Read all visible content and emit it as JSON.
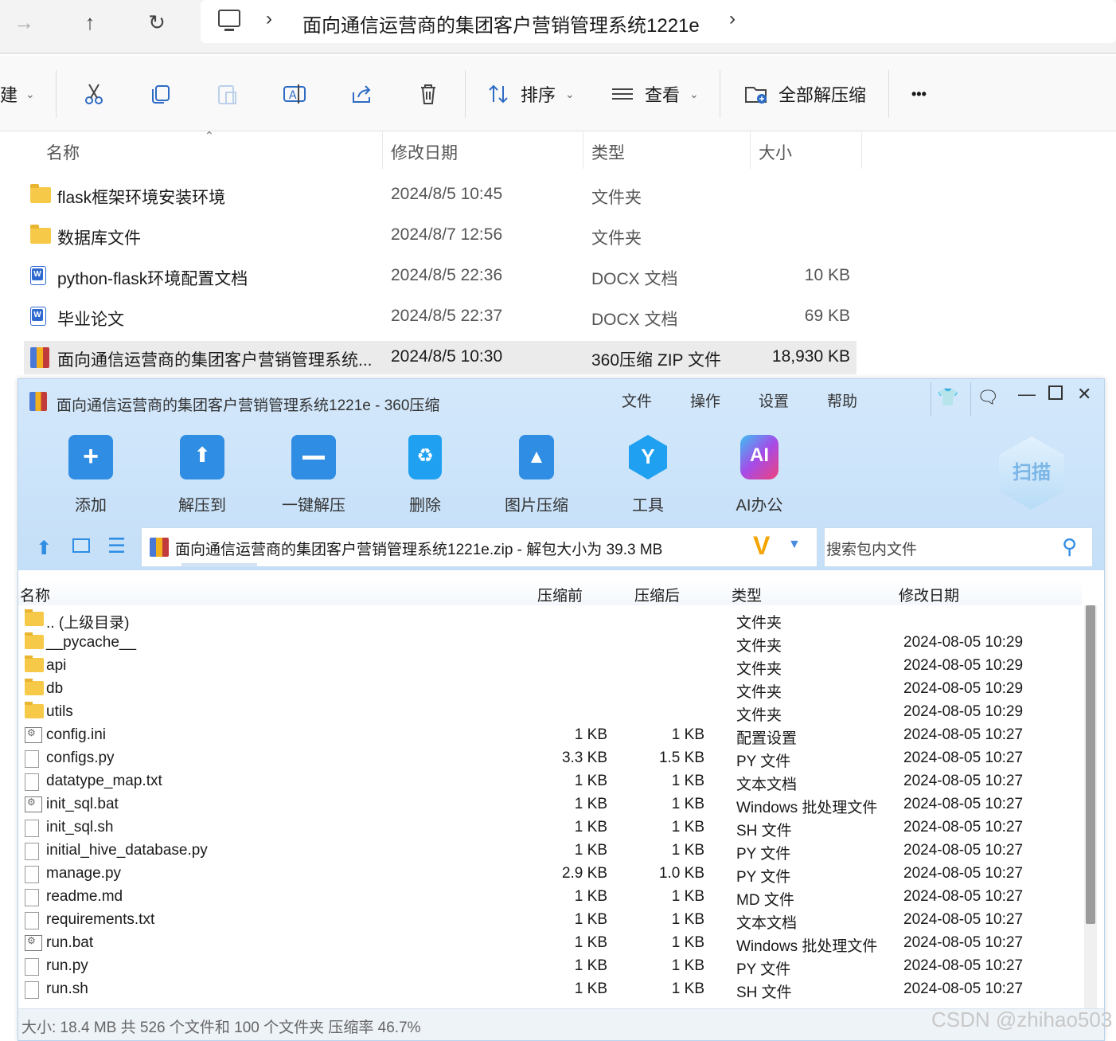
{
  "address": {
    "path": "面向通信运营商的集团客户营销管理系统1221e"
  },
  "toolbar": {
    "new_partial": "建",
    "sort": "排序",
    "view": "查看",
    "extract_all": "全部解压缩",
    "more": "•••"
  },
  "file_list": {
    "headers": {
      "name": "名称",
      "date": "修改日期",
      "type": "类型",
      "size": "大小"
    },
    "rows": [
      {
        "name": "flask框架环境安装环境",
        "date": "2024/8/5 10:45",
        "type": "文件夹",
        "size": "",
        "icon": "folder-icon"
      },
      {
        "name": "数据库文件",
        "date": "2024/8/7 12:56",
        "type": "文件夹",
        "size": "",
        "icon": "folder-icon"
      },
      {
        "name": "python-flask环境配置文档",
        "date": "2024/8/5 22:36",
        "type": "DOCX 文档",
        "size": "10 KB",
        "icon": "docx-icon"
      },
      {
        "name": "毕业论文",
        "date": "2024/8/5 22:37",
        "type": "DOCX 文档",
        "size": "69 KB",
        "icon": "docx-icon"
      },
      {
        "name": "面向通信运营商的集团客户营销管理系统...",
        "date": "2024/8/5 10:30",
        "type": "360压缩 ZIP 文件",
        "size": "18,930 KB",
        "icon": "zip-icon"
      }
    ]
  },
  "zip_window": {
    "title": "面向通信运营商的集团客户营销管理系统1221e - 360压缩",
    "menu": [
      "文件",
      "操作",
      "设置",
      "帮助"
    ],
    "buttons": [
      "添加",
      "解压到",
      "一键解压",
      "删除",
      "图片压缩",
      "工具",
      "AI办公"
    ],
    "scan": "扫描",
    "path_text": "面向通信运营商的集团客户营销管理系统1221e.zip - 解包大小为 39.3 MB",
    "search_placeholder": "搜索包内文件",
    "headers": {
      "name": "名称",
      "before": "压缩前",
      "after": "压缩后",
      "type": "类型",
      "date": "修改日期"
    },
    "rows": [
      {
        "name": ".. (上级目录)",
        "before": "",
        "after": "",
        "type": "文件夹",
        "date": "",
        "icon": "folder"
      },
      {
        "name": "__pycache__",
        "before": "",
        "after": "",
        "type": "文件夹",
        "date": "2024-08-05 10:29",
        "icon": "folder"
      },
      {
        "name": "api",
        "before": "",
        "after": "",
        "type": "文件夹",
        "date": "2024-08-05 10:29",
        "icon": "folder"
      },
      {
        "name": "db",
        "before": "",
        "after": "",
        "type": "文件夹",
        "date": "2024-08-05 10:29",
        "icon": "folder"
      },
      {
        "name": "utils",
        "before": "",
        "after": "",
        "type": "文件夹",
        "date": "2024-08-05 10:29",
        "icon": "folder"
      },
      {
        "name": "config.ini",
        "before": "1 KB",
        "after": "1 KB",
        "type": "配置设置",
        "date": "2024-08-05 10:27",
        "icon": "gear"
      },
      {
        "name": "configs.py",
        "before": "3.3 KB",
        "after": "1.5 KB",
        "type": "PY 文件",
        "date": "2024-08-05 10:27",
        "icon": "file"
      },
      {
        "name": "datatype_map.txt",
        "before": "1 KB",
        "after": "1 KB",
        "type": "文本文档",
        "date": "2024-08-05 10:27",
        "icon": "file"
      },
      {
        "name": "init_sql.bat",
        "before": "1 KB",
        "after": "1 KB",
        "type": "Windows 批处理文件",
        "date": "2024-08-05 10:27",
        "icon": "gear"
      },
      {
        "name": "init_sql.sh",
        "before": "1 KB",
        "after": "1 KB",
        "type": "SH 文件",
        "date": "2024-08-05 10:27",
        "icon": "file"
      },
      {
        "name": "initial_hive_database.py",
        "before": "1 KB",
        "after": "1 KB",
        "type": "PY 文件",
        "date": "2024-08-05 10:27",
        "icon": "file"
      },
      {
        "name": "manage.py",
        "before": "2.9 KB",
        "after": "1.0 KB",
        "type": "PY 文件",
        "date": "2024-08-05 10:27",
        "icon": "file"
      },
      {
        "name": "readme.md",
        "before": "1 KB",
        "after": "1 KB",
        "type": "MD 文件",
        "date": "2024-08-05 10:27",
        "icon": "file"
      },
      {
        "name": "requirements.txt",
        "before": "1 KB",
        "after": "1 KB",
        "type": "文本文档",
        "date": "2024-08-05 10:27",
        "icon": "file"
      },
      {
        "name": "run.bat",
        "before": "1 KB",
        "after": "1 KB",
        "type": "Windows 批处理文件",
        "date": "2024-08-05 10:27",
        "icon": "gear"
      },
      {
        "name": "run.py",
        "before": "1 KB",
        "after": "1 KB",
        "type": "PY 文件",
        "date": "2024-08-05 10:27",
        "icon": "file"
      },
      {
        "name": "run.sh",
        "before": "1 KB",
        "after": "1 KB",
        "type": "SH 文件",
        "date": "2024-08-05 10:27",
        "icon": "file"
      }
    ],
    "status": "大小: 18.4 MB 共 526 个文件和 100 个文件夹 压缩率 46.7%"
  },
  "watermark": "CSDN @zhihao503"
}
